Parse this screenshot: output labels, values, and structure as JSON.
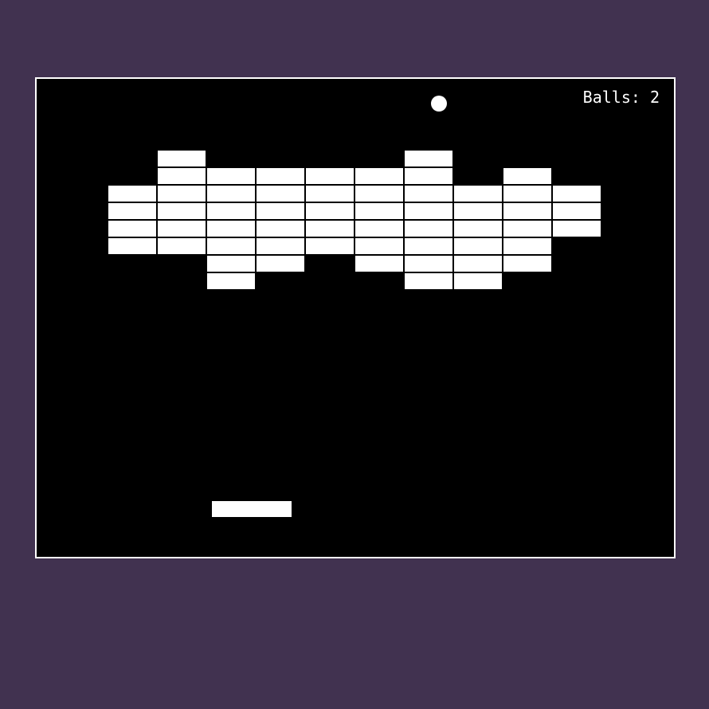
{
  "game": {
    "balls_label": "Balls:",
    "balls_remaining": 2,
    "balls_text": "Balls: 2"
  },
  "colors": {
    "background": "#413250",
    "board": "#000000",
    "border": "#ffffff",
    "bricks": "#ffffff",
    "paddle": "#ffffff",
    "ball": "#ffffff",
    "text": "#ffffff"
  },
  "bricks": {
    "grid_columns": 10,
    "grid_rows": 8,
    "rows": [
      [
        0,
        1,
        0,
        0,
        0,
        0,
        1,
        0,
        0,
        0
      ],
      [
        0,
        1,
        1,
        1,
        1,
        1,
        1,
        0,
        1,
        0
      ],
      [
        1,
        1,
        1,
        1,
        1,
        1,
        1,
        1,
        1,
        1
      ],
      [
        1,
        1,
        1,
        1,
        1,
        1,
        1,
        1,
        1,
        1
      ],
      [
        1,
        1,
        1,
        1,
        1,
        1,
        1,
        1,
        1,
        1
      ],
      [
        1,
        1,
        1,
        1,
        1,
        1,
        1,
        1,
        1,
        0
      ],
      [
        0,
        0,
        1,
        1,
        0,
        1,
        1,
        1,
        1,
        0
      ],
      [
        0,
        0,
        1,
        0,
        0,
        0,
        1,
        1,
        0,
        0
      ]
    ]
  }
}
